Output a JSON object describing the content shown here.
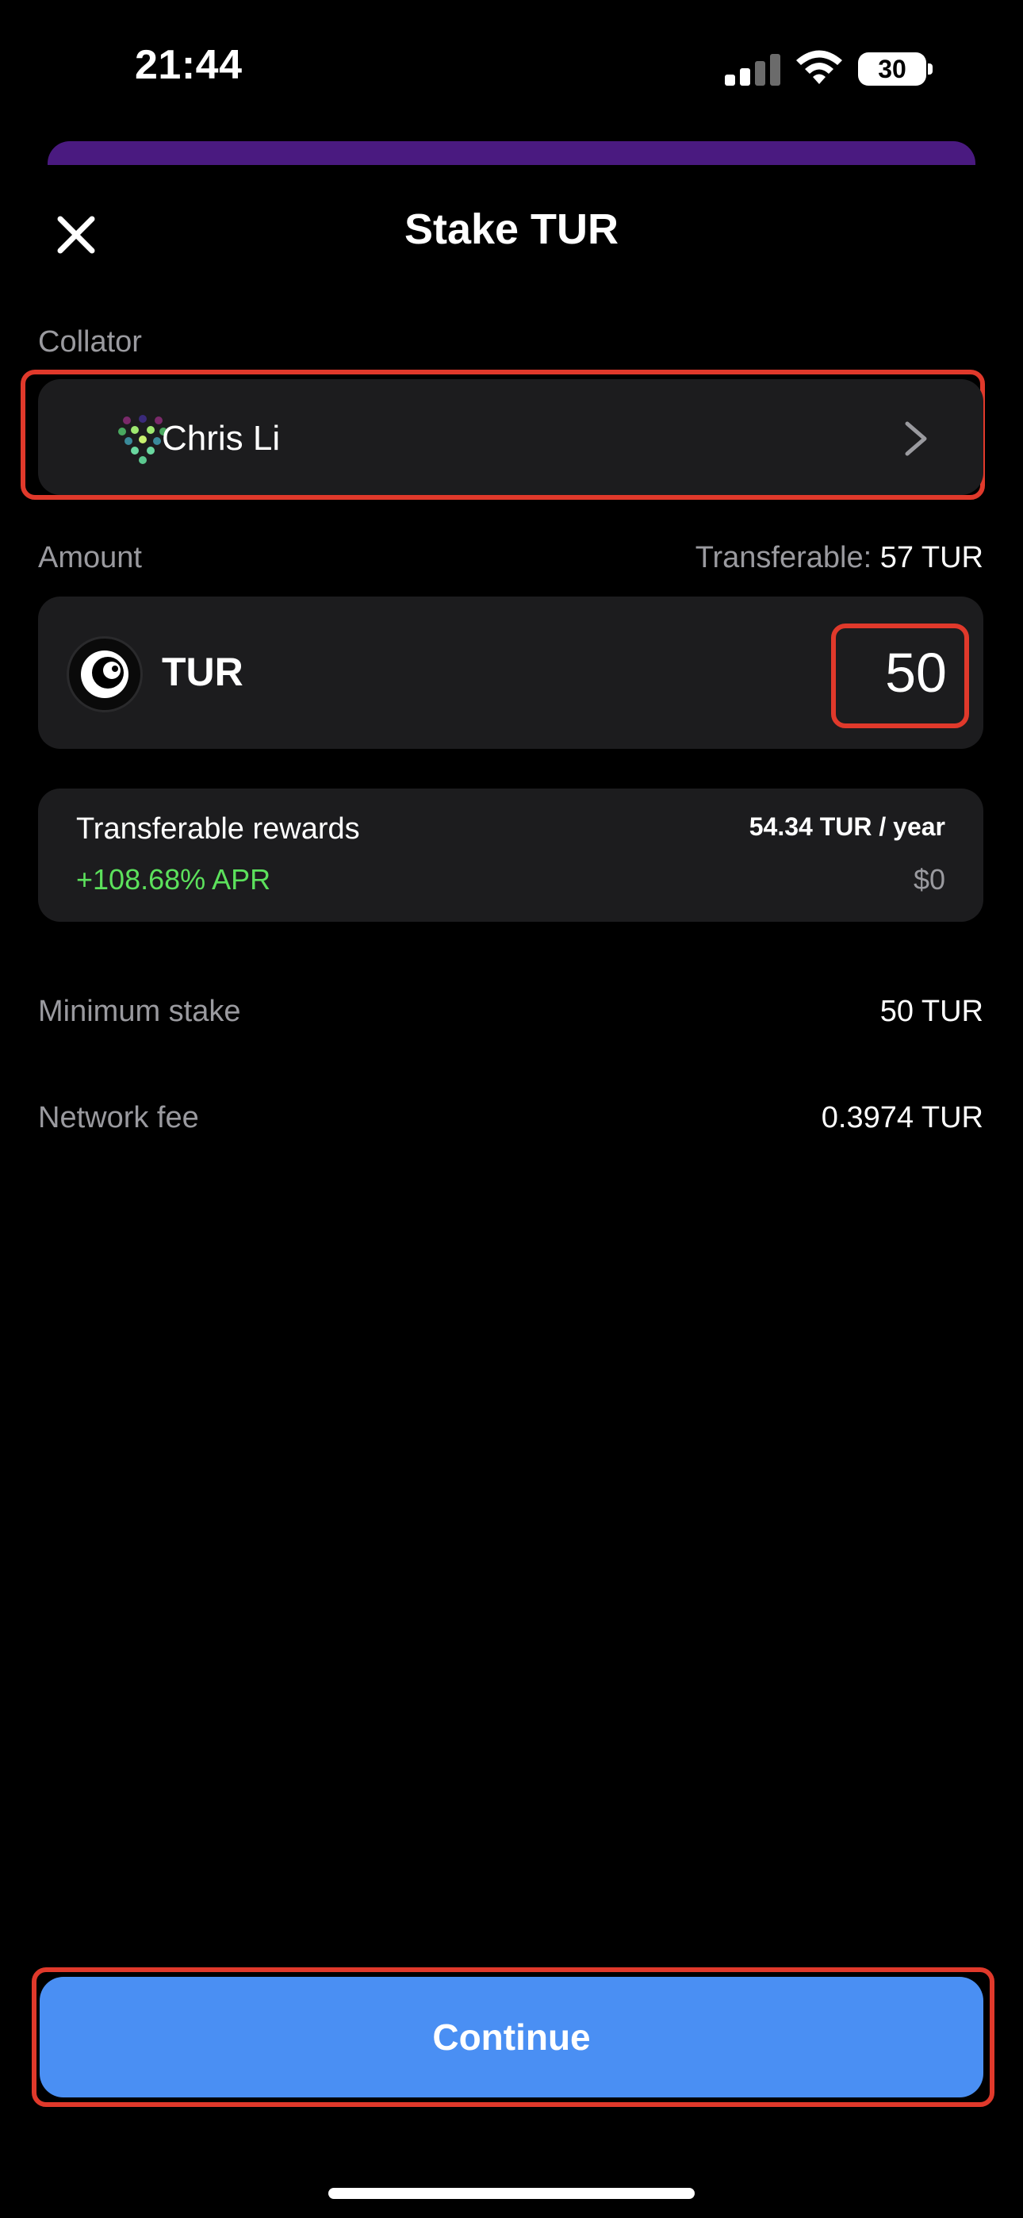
{
  "status_bar": {
    "time": "21:44",
    "battery": "30"
  },
  "header": {
    "title": "Stake TUR",
    "close_icon": "close-icon"
  },
  "collator": {
    "label": "Collator",
    "name": "Chris Li",
    "avatar_icon": "identicon-avatar",
    "chevron_icon": "chevron-right-icon"
  },
  "amount": {
    "label": "Amount",
    "transferable_label": "Transferable:",
    "transferable_value": "57 TUR",
    "token_symbol": "TUR",
    "token_icon": "turing-token-icon",
    "value": "50"
  },
  "rewards": {
    "title": "Transferable rewards",
    "apr": "+108.68% APR",
    "per_year": "54.34 TUR / year",
    "usd": "$0"
  },
  "details": {
    "minimum_stake_label": "Minimum stake",
    "minimum_stake_value": "50 TUR",
    "network_fee_label": "Network fee",
    "network_fee_value": "0.3974 TUR"
  },
  "footer": {
    "continue_label": "Continue"
  },
  "colors": {
    "background": "#000000",
    "card": "#1c1c1e",
    "accent_blue": "#4a8ff3",
    "apr_green": "#5ce15c",
    "highlight_red": "#e0392b",
    "secondary_text": "#9a9a9f"
  }
}
